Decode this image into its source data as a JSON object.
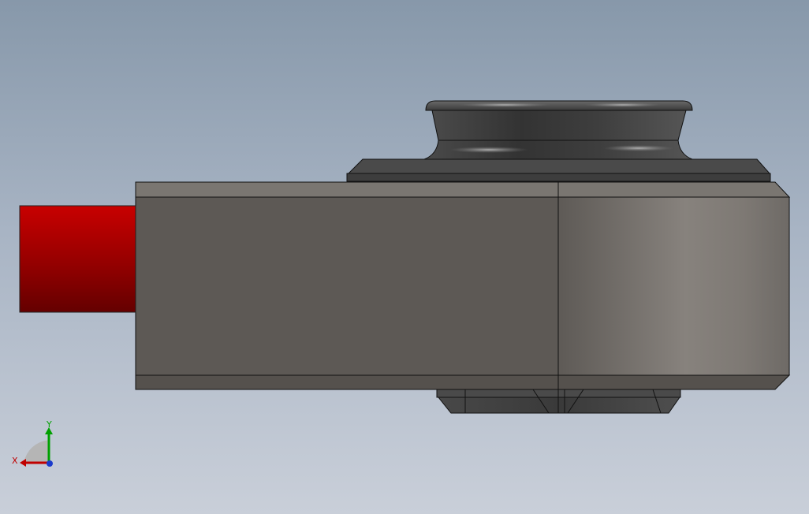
{
  "viewport": {
    "background_top": "#8798aa",
    "background_bottom": "#c9cfd9"
  },
  "model": {
    "body_color": "#5d5955",
    "side_face_color": "#85807b",
    "bevel_color": "#7a7671",
    "dark_part_color": "#3c3c3c",
    "pin_color": "#b00000",
    "pin_dark_color": "#6a0000",
    "edge_color": "#111111"
  },
  "triad": {
    "x_label": "X",
    "y_label": "Y",
    "x_color": "#c00000",
    "y_color": "#00a000",
    "z_color": "#1a3acc"
  }
}
